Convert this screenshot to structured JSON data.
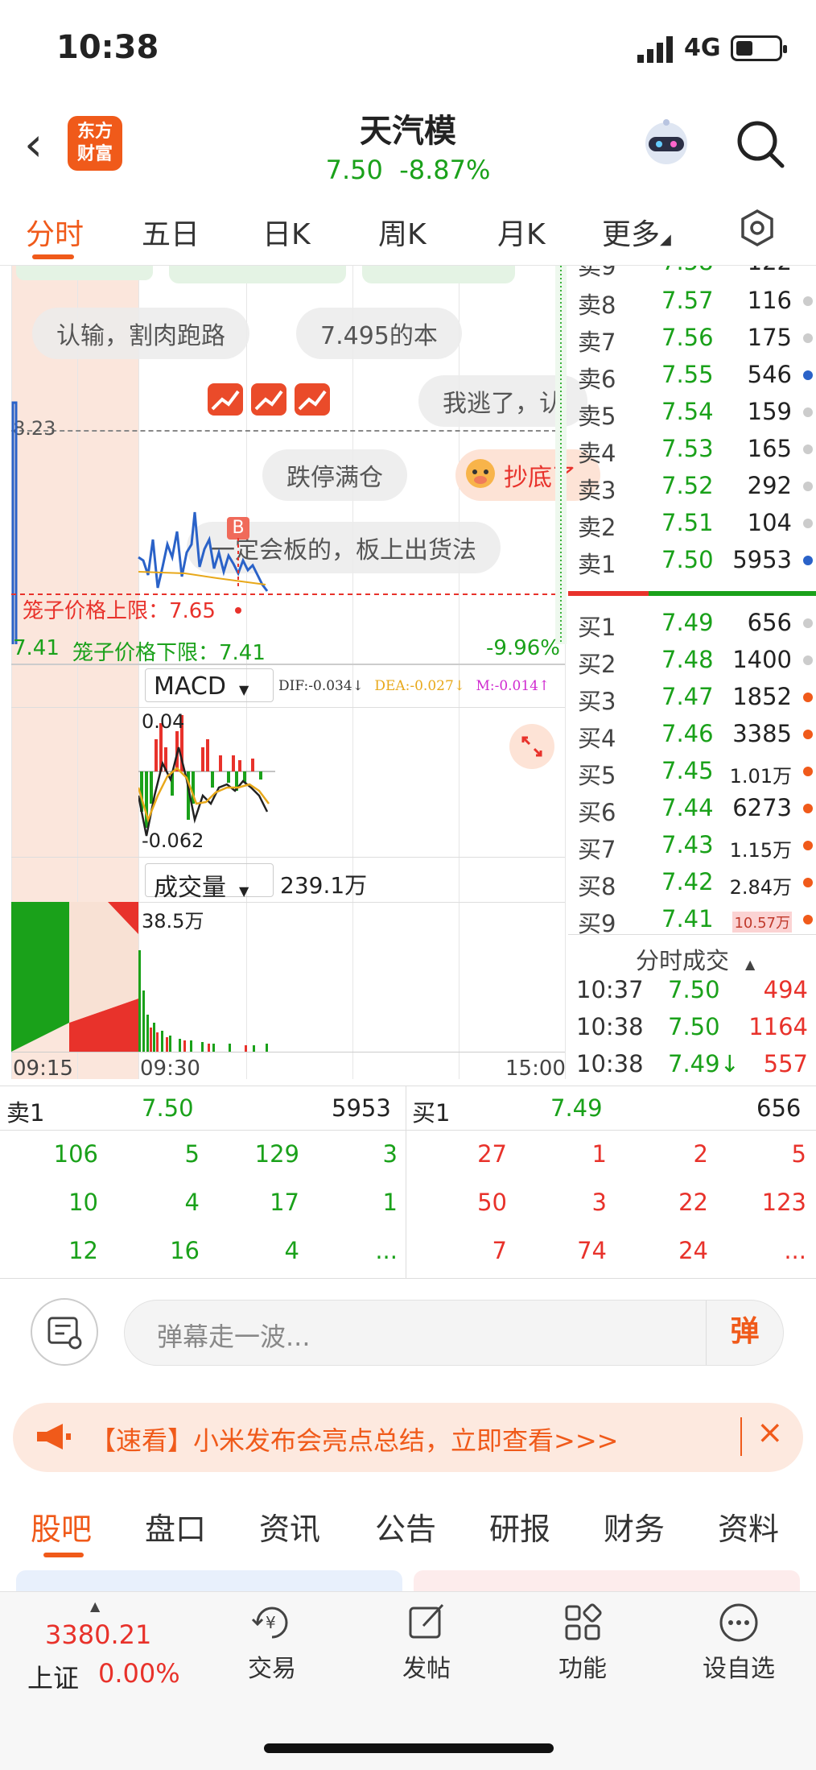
{
  "status": {
    "time": "10:38",
    "network": "4G"
  },
  "header": {
    "logo_line1": "东方",
    "logo_line2": "财富",
    "stock_name": "天汽模",
    "price": "7.50",
    "change": "-8.87%"
  },
  "tabs": [
    "分时",
    "五日",
    "日K",
    "周K",
    "月K",
    "更多"
  ],
  "chart": {
    "ref_price": "8.23",
    "upper_limit_label": "笼子价格上限：7.65",
    "lower_limit_price": "7.41",
    "lower_limit_label": "笼子价格下限：7.41",
    "pct_low": "-9.96%",
    "bubbles": [
      "认输，割肉跑路",
      "7.495的本",
      "我逃了，认",
      "跌停满仓",
      "抄底了",
      "一定会板的，板上出货法"
    ],
    "buy_marker": "B",
    "macd": {
      "label": "MACD",
      "dif": "DIF:-0.034↓",
      "dea": "DEA:-0.027↓",
      "m": "M:-0.014↑",
      "top": "0.04",
      "bottom": "-0.062"
    },
    "volume": {
      "label": "成交量",
      "total": "239.1万",
      "peak": "38.5万"
    },
    "times": [
      "09:15",
      "09:30",
      "15:00"
    ]
  },
  "book": {
    "sells": [
      {
        "label": "卖8",
        "price": "7.57",
        "vol": "116"
      },
      {
        "label": "卖7",
        "price": "7.56",
        "vol": "175"
      },
      {
        "label": "卖6",
        "price": "7.55",
        "vol": "546"
      },
      {
        "label": "卖5",
        "price": "7.54",
        "vol": "159"
      },
      {
        "label": "卖4",
        "price": "7.53",
        "vol": "165"
      },
      {
        "label": "卖3",
        "price": "7.52",
        "vol": "292"
      },
      {
        "label": "卖2",
        "price": "7.51",
        "vol": "104"
      },
      {
        "label": "卖1",
        "price": "7.50",
        "vol": "5953"
      }
    ],
    "buys": [
      {
        "label": "买1",
        "price": "7.49",
        "vol": "656"
      },
      {
        "label": "买2",
        "price": "7.48",
        "vol": "1400"
      },
      {
        "label": "买3",
        "price": "7.47",
        "vol": "1852"
      },
      {
        "label": "买4",
        "price": "7.46",
        "vol": "3385"
      },
      {
        "label": "买5",
        "price": "7.45",
        "vol": "1.01万"
      },
      {
        "label": "买6",
        "price": "7.44",
        "vol": "6273"
      },
      {
        "label": "买7",
        "price": "7.43",
        "vol": "1.15万"
      },
      {
        "label": "买8",
        "price": "7.42",
        "vol": "2.84万"
      },
      {
        "label": "买9",
        "price": "7.41",
        "vol": "10.57万"
      }
    ],
    "trades_title": "分时成交",
    "trades": [
      {
        "time": "10:37",
        "price": "7.50",
        "vol": "494"
      },
      {
        "time": "10:38",
        "price": "7.50",
        "vol": "1164"
      },
      {
        "time": "10:38",
        "price": "7.49↓",
        "vol": "557"
      }
    ]
  },
  "queue": {
    "sell_label": "卖1",
    "sell_price": "7.50",
    "sell_vol": "5953",
    "buy_label": "买1",
    "buy_price": "7.49",
    "buy_vol": "656",
    "sell_rows": [
      [
        "106",
        "5",
        "129",
        "3"
      ],
      [
        "10",
        "4",
        "17",
        "1"
      ],
      [
        "12",
        "16",
        "4",
        "..."
      ]
    ],
    "buy_rows": [
      [
        "27",
        "1",
        "2",
        "5"
      ],
      [
        "50",
        "3",
        "22",
        "123"
      ],
      [
        "7",
        "74",
        "24",
        "..."
      ]
    ]
  },
  "danmu": {
    "placeholder": "弹幕走一波...",
    "button": "弹"
  },
  "promo": {
    "text": "【速看】小米发布会亮点总结，立即查看>>>"
  },
  "subtabs": [
    "股吧",
    "盘口",
    "资讯",
    "公告",
    "研报",
    "财务",
    "资料"
  ],
  "bottom": {
    "index_value": "3380.21",
    "index_name": "上证",
    "index_change": "0.00%",
    "items": [
      "交易",
      "发帖",
      "功能",
      "设自选"
    ]
  }
}
